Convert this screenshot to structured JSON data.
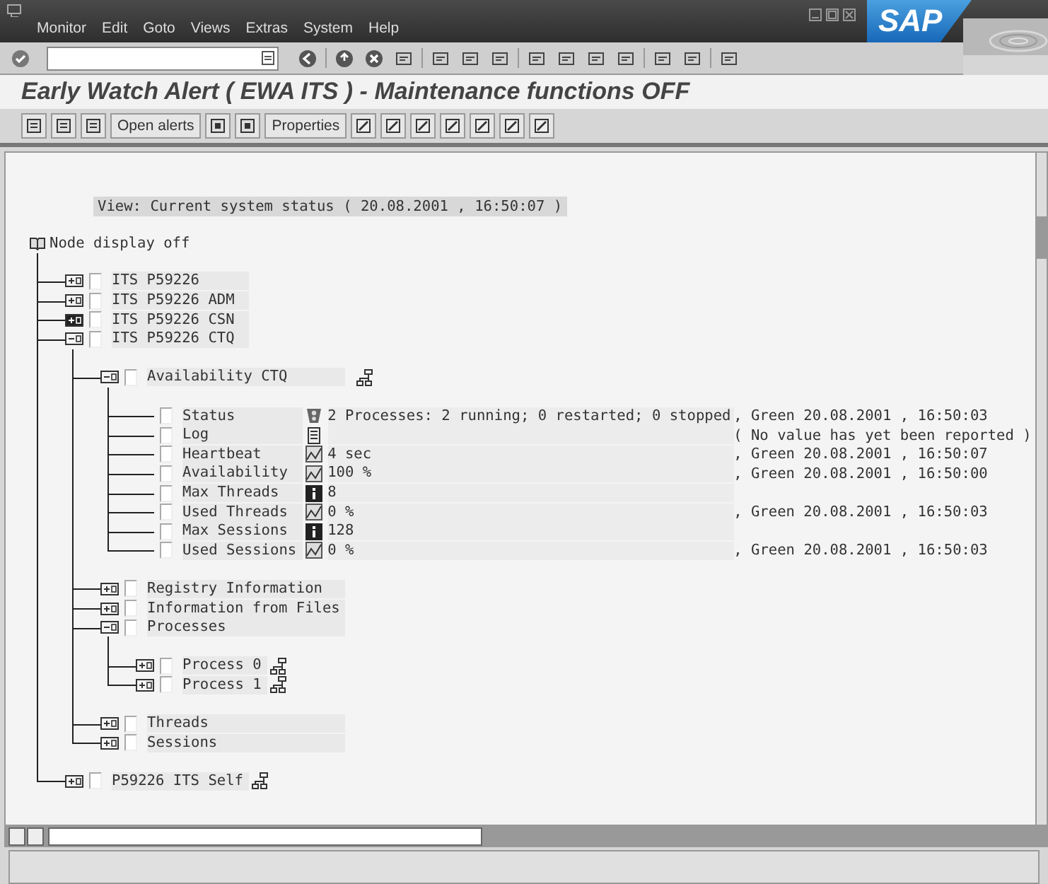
{
  "window": {
    "menu": [
      "Monitor",
      "Edit",
      "Goto",
      "Views",
      "Extras",
      "System",
      "Help"
    ],
    "logo": "SAP"
  },
  "title": "Early Watch Alert ( EWA ITS ) - Maintenance functions OFF",
  "app_toolbar": {
    "buttons": [
      "Open alerts",
      "Properties"
    ]
  },
  "view_line": "View: Current system status ( 20.08.2001 , 16:50:07 )",
  "tree": {
    "label": "Node display off",
    "children": [
      {
        "label": "ITS P59226",
        "expanded": false,
        "checked": false,
        "selected": false
      },
      {
        "label": "ITS P59226 ADM",
        "expanded": false,
        "checked": false,
        "selected": false
      },
      {
        "label": "ITS P59226 CSN",
        "expanded": false,
        "checked": false,
        "selected": true
      },
      {
        "label": "ITS P59226 CTQ",
        "expanded": true,
        "checked": false,
        "selected": false,
        "children": [
          {
            "label": "Availability CTQ",
            "expanded": true,
            "checked": false,
            "selected": false,
            "kind": "hierarchy",
            "children": [
              {
                "label": "Status",
                "checked": false,
                "kind": "status",
                "value": "2 Processes: 2 running; 0 restarted; 0 stopped",
                "detail": ", Green 20.08.2001 , 16:50:03"
              },
              {
                "label": "Log",
                "checked": false,
                "kind": "log",
                "detail": "( No value has yet been reported )"
              },
              {
                "label": "Heartbeat",
                "checked": false,
                "kind": "curve",
                "value": "4 sec",
                "detail": ", Green 20.08.2001 , 16:50:07"
              },
              {
                "label": "Availability",
                "checked": false,
                "kind": "curve",
                "value": "100 %",
                "detail": ", Green 20.08.2001 , 16:50:00"
              },
              {
                "label": "Max Threads",
                "checked": false,
                "kind": "info",
                "value": "8"
              },
              {
                "label": "Used Threads",
                "checked": false,
                "kind": "curve",
                "value": "0 %",
                "detail": ", Green 20.08.2001 , 16:50:03"
              },
              {
                "label": "Max Sessions",
                "checked": false,
                "kind": "info",
                "value": "128"
              },
              {
                "label": "Used Sessions",
                "checked": false,
                "kind": "curve",
                "value": "0 %",
                "detail": ", Green 20.08.2001 , 16:50:03"
              }
            ]
          },
          {
            "label": "Registry Information",
            "expanded": false,
            "checked": false,
            "selected": false
          },
          {
            "label": "Information from Files",
            "expanded": false,
            "checked": false,
            "selected": false
          },
          {
            "label": "Processes",
            "expanded": true,
            "checked": false,
            "selected": false,
            "children": [
              {
                "label": "Process 0",
                "expanded": false,
                "checked": false,
                "selected": false,
                "kind": "hierarchy"
              },
              {
                "label": "Process 1",
                "expanded": false,
                "checked": false,
                "selected": false,
                "kind": "hierarchy"
              }
            ]
          },
          {
            "label": "Threads",
            "expanded": false,
            "checked": false,
            "selected": false
          },
          {
            "label": "Sessions",
            "expanded": false,
            "checked": false,
            "selected": false
          }
        ]
      },
      {
        "label": "P59226 ITS Self",
        "expanded": false,
        "checked": false,
        "selected": false,
        "kind": "hierarchy"
      }
    ]
  }
}
